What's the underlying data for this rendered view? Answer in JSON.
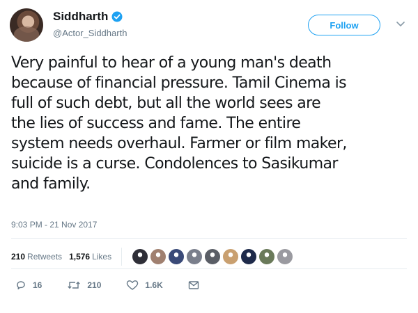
{
  "user": {
    "display_name": "Siddharth",
    "handle": "@Actor_Siddharth",
    "verified": true
  },
  "follow_label": "Follow",
  "tweet": {
    "lines": [
      "Very painful to hear of a young man's death",
      "because of financial pressure. Tamil Cinema is",
      "full of such debt, but all the world sees are",
      "the lies of success and fame. The entire",
      "system needs overhaul. Farmer or film maker,",
      "suicide is a curse. Condolences to Sasikumar",
      "and family."
    ],
    "timestamp": "9:03 PM - 21 Nov 2017"
  },
  "stats": {
    "retweets_count": "210",
    "retweets_label": "Retweets",
    "likes_count": "1,576",
    "likes_label": "Likes"
  },
  "liker_avatar_colors": [
    "#2f2f38",
    "#a08070",
    "#3a4a78",
    "#7a7f8c",
    "#5a5e66",
    "#c9a070",
    "#1e2a4a",
    "#6a7a5a",
    "#9a9aa0"
  ],
  "actions": {
    "reply_count": "16",
    "retweet_count": "210",
    "like_count": "1.6K"
  },
  "colors": {
    "accent": "#1da1f2",
    "secondary_text": "#657786",
    "divider": "#e6ecf0"
  }
}
